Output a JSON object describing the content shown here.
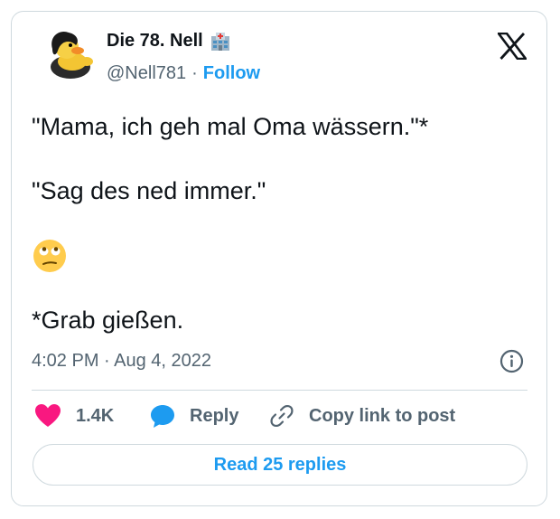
{
  "author": {
    "display_name": "Die 78. Nell",
    "handle": "@Nell781",
    "separator": "·",
    "follow_label": "Follow"
  },
  "tweet": {
    "line1": "\"Mama, ich geh mal Oma wässern.\"*",
    "line2": "\"Sag des ned immer.\"",
    "emoji": "face-with-rolling-eyes",
    "line3": "*Grab gießen.",
    "timestamp": "4:02 PM · Aug 4, 2022"
  },
  "actions": {
    "like_count": "1.4K",
    "reply_label": "Reply",
    "copy_label": "Copy link to post"
  },
  "read_replies_label": "Read 25 replies",
  "colors": {
    "accent": "#1d9bf0",
    "heart": "#f91880",
    "muted": "#536471",
    "border": "#cfd9de"
  }
}
